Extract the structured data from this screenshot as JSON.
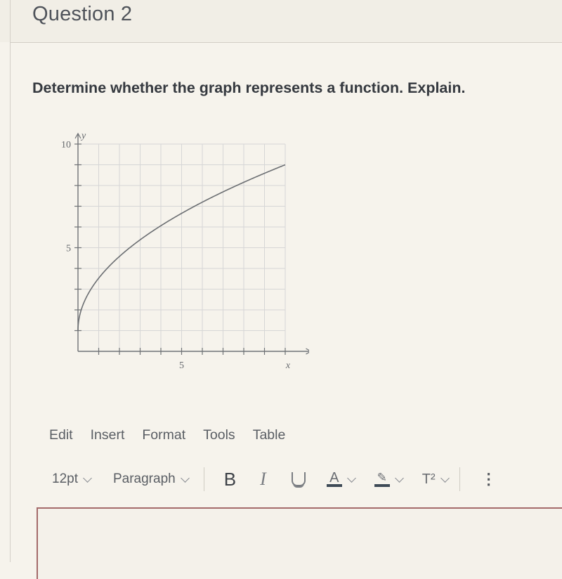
{
  "question": {
    "title": "Question 2",
    "prompt": "Determine whether the graph represents a function. Explain."
  },
  "chart_data": {
    "type": "line",
    "title": "",
    "xlabel": "x",
    "ylabel": "y",
    "xlim": [
      0,
      11
    ],
    "ylim": [
      0,
      10
    ],
    "x_ticks_labeled": [
      {
        "value": 5,
        "label": "5"
      }
    ],
    "y_ticks_labeled": [
      {
        "value": 5,
        "label": "5"
      },
      {
        "value": 10,
        "label": "10"
      }
    ],
    "grid": true,
    "series": [
      {
        "name": "curve",
        "description": "square-root shaped curve starting at (0,1) ending near (10,9)",
        "x": [
          0,
          0.25,
          0.5,
          1,
          2,
          3,
          4,
          5,
          6,
          7,
          8,
          9,
          10
        ],
        "y": [
          1,
          2.26,
          2.79,
          3.53,
          4.58,
          5.38,
          6.06,
          6.66,
          7.2,
          7.69,
          8.15,
          8.59,
          9.0
        ]
      }
    ]
  },
  "editor": {
    "menu": [
      "Edit",
      "Insert",
      "Format",
      "Tools",
      "Table"
    ],
    "font_size": "12pt",
    "block_format": "Paragraph",
    "buttons": {
      "bold": "B",
      "italic": "I",
      "underline": "U",
      "text_color": "A",
      "superscript": "T²",
      "more": "⋮"
    },
    "colors": {
      "underline_bar": "#3e4a56",
      "editor_border": "#a46a6a"
    },
    "content": ""
  }
}
